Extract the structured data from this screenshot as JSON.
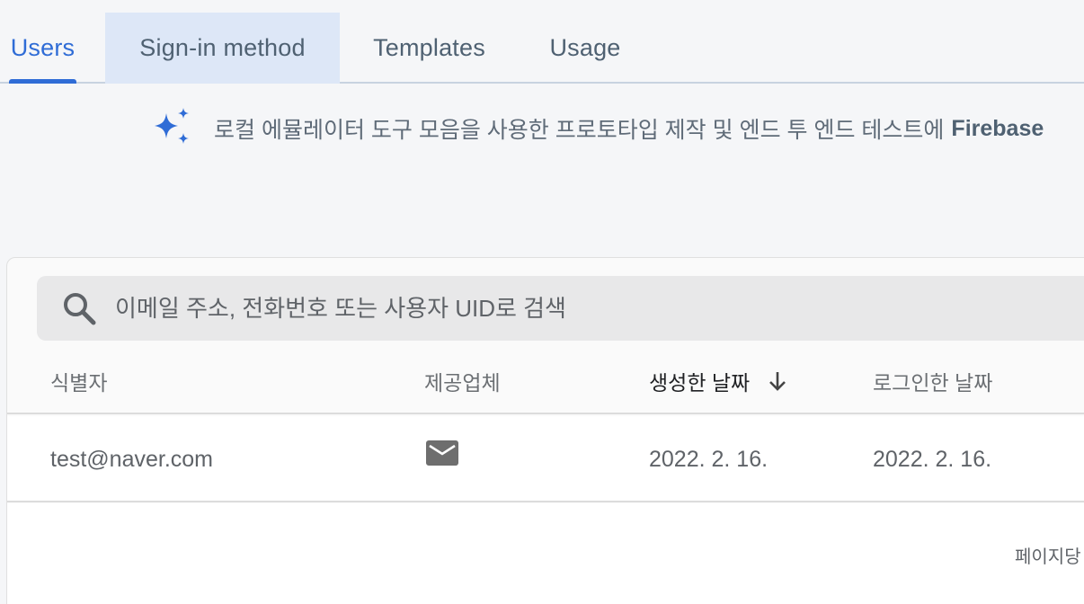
{
  "tabs": [
    {
      "label": "Users"
    },
    {
      "label": "Sign-in method"
    },
    {
      "label": "Templates"
    },
    {
      "label": "Usage"
    }
  ],
  "banner": {
    "text": "로컬 에뮬레이터 도구 모음을 사용한 프로토타입 제작 및 엔드 투 엔드 테스트에",
    "strong": "Firebase",
    "icon": "sparkle-icon"
  },
  "search": {
    "placeholder": "이메일 주소, 전화번호 또는 사용자 UID로 검색"
  },
  "table": {
    "headers": {
      "identifier": "식별자",
      "provider": "제공업체",
      "created": "생성한 날짜",
      "signed_in": "로그인한 날짜"
    },
    "rows": [
      {
        "identifier": "test@naver.com",
        "provider_icon": "email-icon",
        "created": "2022. 2. 16.",
        "signed_in": "2022. 2. 16."
      }
    ]
  },
  "pagination": {
    "label": "페이지당"
  },
  "colors": {
    "accent": "#2f6cd6",
    "tab_hover": "#dde7f7",
    "background": "#f5f6f8"
  }
}
